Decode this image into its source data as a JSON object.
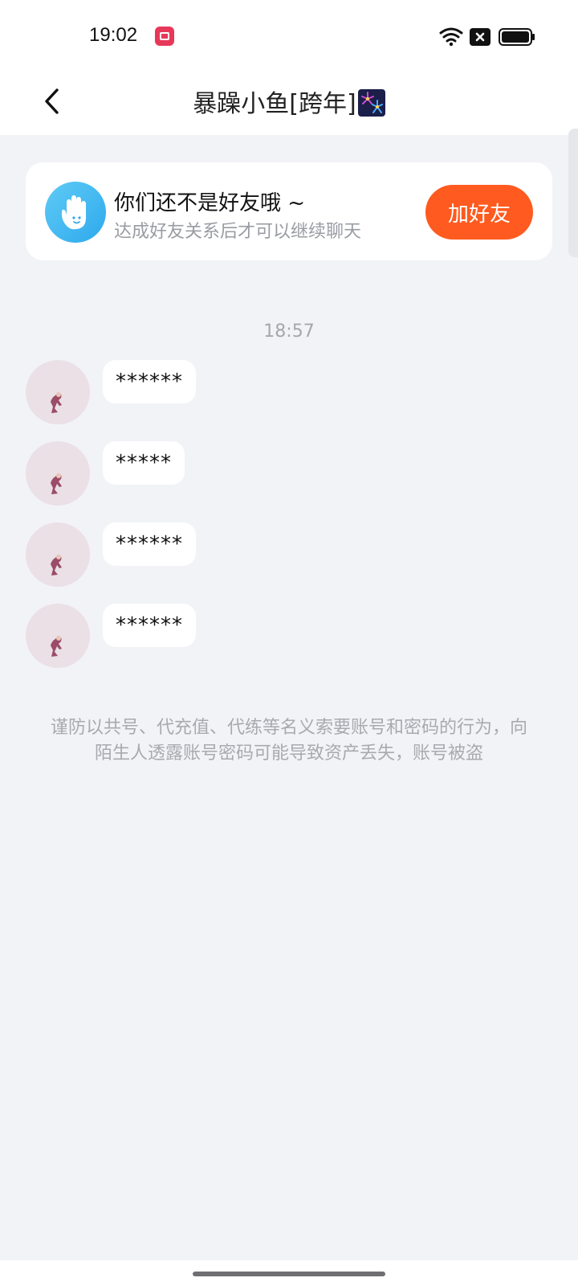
{
  "status_bar": {
    "time": "19:02",
    "icons": [
      "screen-record-icon",
      "wifi-icon",
      "battery-x-icon",
      "battery-icon"
    ]
  },
  "header": {
    "title": "暴躁小鱼[跨年]",
    "title_emoji_icon": "firework-icon",
    "back_icon": "chevron-left-icon"
  },
  "friend_notice": {
    "title": "你们还不是好友哦 ~",
    "subtitle": "达成好友关系后才可以继续聊天",
    "button_label": "加好友",
    "icon": "hand-wave-icon",
    "accent_color": "#ff5a1f"
  },
  "chat": {
    "timestamp": "18:57",
    "messages": [
      {
        "text": "******"
      },
      {
        "text": "*****"
      },
      {
        "text": "******"
      },
      {
        "text": "******"
      }
    ]
  },
  "warning_text": "谨防以共号、代充值、代练等名义索要账号和密码的行为，向陌生人透露账号密码可能导致资产丢失，账号被盗"
}
